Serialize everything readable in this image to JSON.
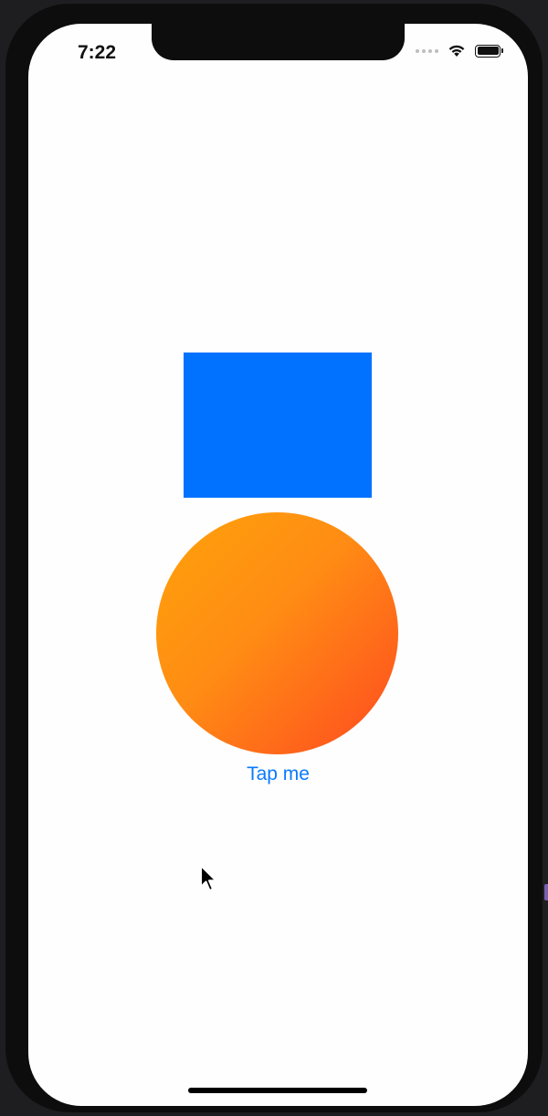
{
  "status_bar": {
    "time": "7:22",
    "icons": [
      "cellular-dots-icon",
      "wifi-icon",
      "battery-icon"
    ]
  },
  "content": {
    "rectangle": {
      "color": "#0072ff"
    },
    "circle": {
      "gradient_start": "#ffa20a",
      "gradient_end": "#ff4a1f"
    },
    "button": {
      "label": "Tap me",
      "color": "#0a7aff"
    }
  },
  "pointer": {
    "icon": "mouse-cursor-icon"
  }
}
